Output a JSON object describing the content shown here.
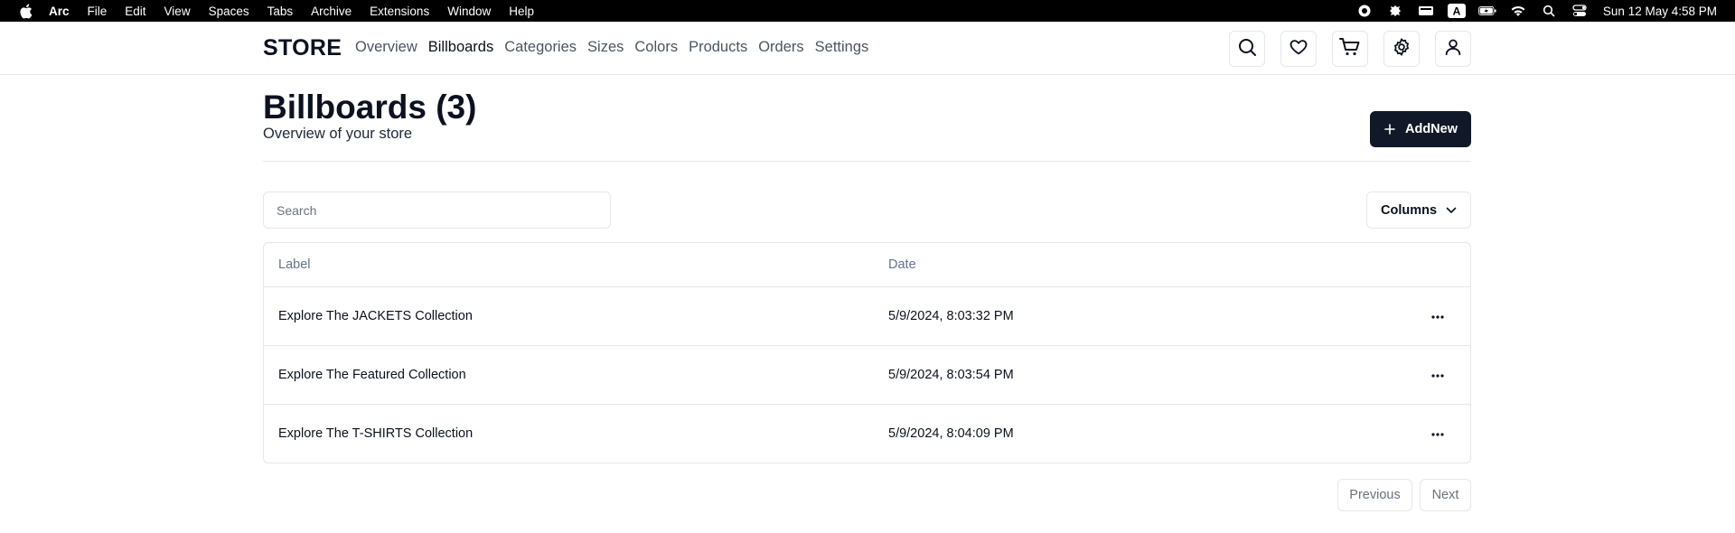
{
  "menubar": {
    "app_name": "Arc",
    "items": [
      "File",
      "Edit",
      "View",
      "Spaces",
      "Tabs",
      "Archive",
      "Extensions",
      "Window",
      "Help"
    ],
    "clock": "Sun 12 May  4:58 PM",
    "input_source": "A"
  },
  "nav": {
    "brand": "STORE",
    "links": [
      "Overview",
      "Billboards",
      "Categories",
      "Sizes",
      "Colors",
      "Products",
      "Orders",
      "Settings"
    ],
    "active": "Billboards"
  },
  "header": {
    "title": "Billboards (3)",
    "subtitle": "Overview of your store",
    "add_button": "AddNew"
  },
  "toolbar": {
    "search_placeholder": "Search",
    "columns_label": "Columns"
  },
  "table": {
    "columns": [
      "Label",
      "Date"
    ],
    "rows": [
      {
        "label": "Explore The JACKETS Collection",
        "date": "5/9/2024, 8:03:32 PM"
      },
      {
        "label": "Explore The Featured Collection",
        "date": "5/9/2024, 8:03:54 PM"
      },
      {
        "label": "Explore The T-SHIRTS Collection",
        "date": "5/9/2024, 8:04:09 PM"
      }
    ]
  },
  "pagination": {
    "previous": "Previous",
    "next": "Next"
  },
  "colors": {
    "primary": "#111827",
    "border": "#e5e7eb",
    "muted": "#64748b"
  }
}
